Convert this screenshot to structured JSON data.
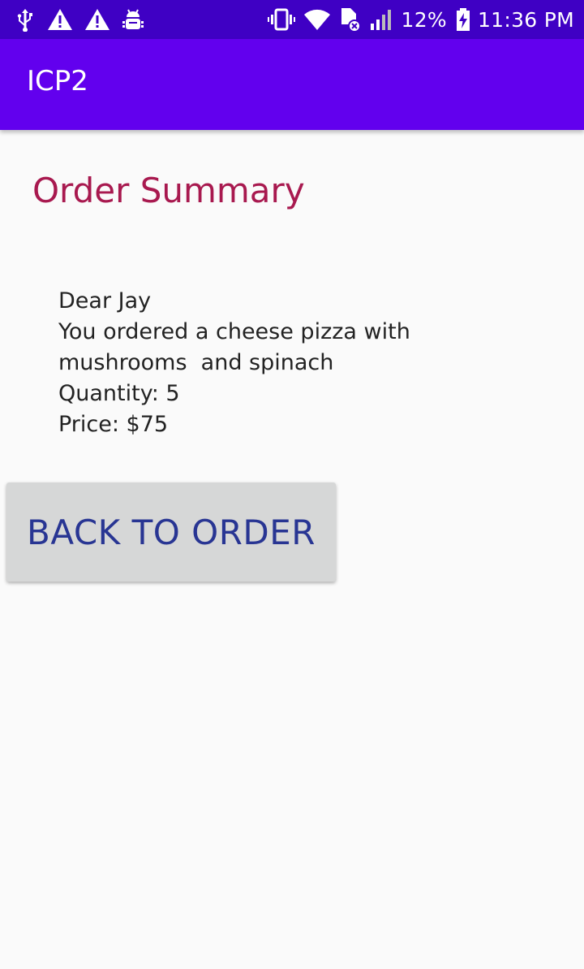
{
  "status_bar": {
    "left_icons": [
      "usb-icon",
      "warning-icon",
      "warning-icon",
      "android-debug-icon"
    ],
    "right_icons": [
      "vibrate-icon",
      "wifi-icon",
      "no-sim-icon",
      "signal-icon",
      "battery-charging-icon"
    ],
    "battery": "12%",
    "time": "11:36 PM"
  },
  "app_bar": {
    "title": "ICP2",
    "color": "#6200ee"
  },
  "order": {
    "title": "Order Summary",
    "greeting": "Dear Jay",
    "line1": "You ordered a cheese pizza with",
    "line2": "mushrooms  and spinach",
    "quantity": "Quantity: 5",
    "price": "Price: $75"
  },
  "actions": {
    "back_label": "BACK TO ORDER"
  },
  "colors": {
    "status_bar": "#3f00c4",
    "title_text": "#a8194f",
    "button_text": "#283593",
    "button_bg": "#d6d7d7"
  }
}
